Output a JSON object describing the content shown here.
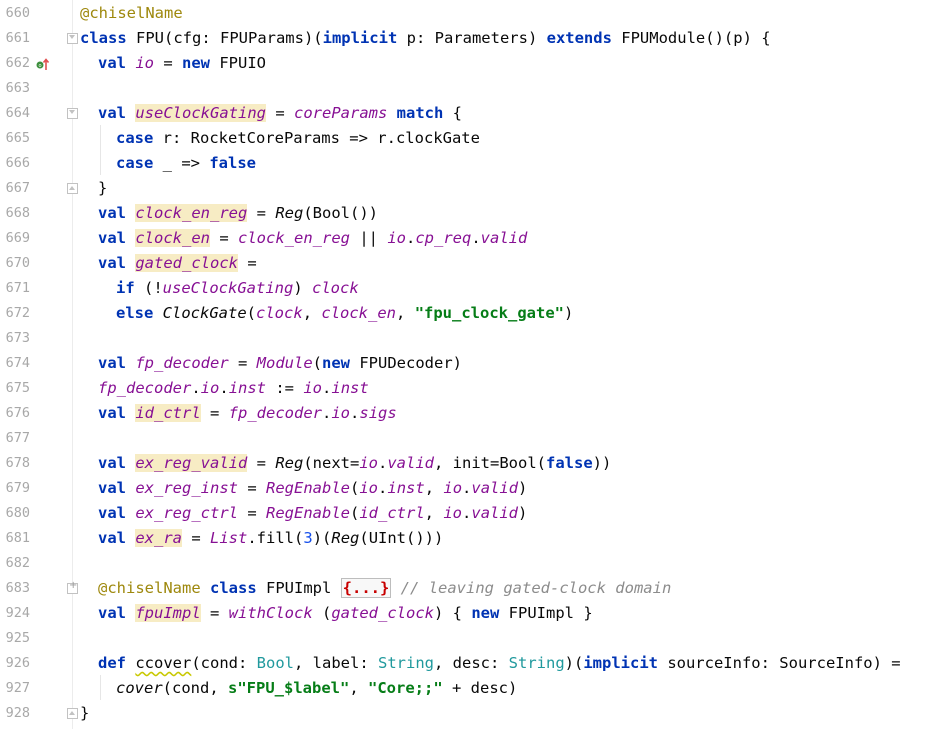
{
  "editor": {
    "first_line": 660,
    "line_numbers": [
      "660",
      "661",
      "662",
      "663",
      "664",
      "665",
      "666",
      "667",
      "668",
      "669",
      "670",
      "671",
      "672",
      "673",
      "674",
      "675",
      "676",
      "677",
      "678",
      "679",
      "680",
      "681",
      "682",
      "683",
      "924",
      "925",
      "926",
      "927",
      "928"
    ],
    "code": {
      "l660": "@chiselName",
      "l661_class": "class",
      "l661_name": " FPU(cfg: FPUParams)(",
      "l661_implicit": "implicit",
      "l661_rest": " p: Parameters) ",
      "l661_extends": "extends",
      "l661_end": " FPUModule()(p) {",
      "l662_val": "val",
      "l662_io": "io",
      "l662_eq": " = ",
      "l662_new": "new",
      "l662_end": " FPUIO",
      "l664_val": "val",
      "l664_name": "useClockGating",
      "l664_eq": " = ",
      "l664_core": "coreParams",
      "l664_match": "match",
      "l664_end": " {",
      "l665_case": "case",
      "l665_rest": " r: RocketCoreParams => r.clockGate",
      "l666_case": "case",
      "l666_rest": " _ => ",
      "l666_false": "false",
      "l667": "}",
      "l668_val": "val",
      "l668_name": "clock_en_reg",
      "l668_eq": " = ",
      "l668_reg": "Reg",
      "l668_end": "(Bool())",
      "l669_val": "val",
      "l669_name": "clock_en",
      "l669_eq": " = ",
      "l669_ref": "clock_en_reg",
      "l669_or": " || ",
      "l669_io": "io",
      "l669_dot": ".",
      "l669_cp": "cp_req",
      "l669_dot2": ".",
      "l669_valid": "valid",
      "l670_val": "val",
      "l670_name": "gated_clock",
      "l670_eq": " =",
      "l671_if": "if",
      "l671_paren": " (!",
      "l671_ucg": "useClockGating",
      "l671_close": ") ",
      "l671_clock": "clock",
      "l672_else": "else",
      "l672_cg": "ClockGate",
      "l672_open": "(",
      "l672_clock": "clock",
      "l672_comma": ", ",
      "l672_clken": "clock_en",
      "l672_comma2": ", ",
      "l672_str": "\"fpu_clock_gate\"",
      "l672_end": ")",
      "l674_val": "val",
      "l674_name": "fp_decoder",
      "l674_eq": " = ",
      "l674_mod": "Module",
      "l674_open": "(",
      "l674_new": "new",
      "l674_end": " FPUDecoder)",
      "l675_fd": "fp_decoder",
      "l675_dot": ".",
      "l675_io": "io",
      "l675_dot2": ".",
      "l675_inst": "inst",
      "l675_assign": " := ",
      "l675_io2": "io",
      "l675_dot3": ".",
      "l675_inst2": "inst",
      "l676_val": "val",
      "l676_name": "id_ctrl",
      "l676_eq": " = ",
      "l676_fd": "fp_decoder",
      "l676_dot": ".",
      "l676_io": "io",
      "l676_dot2": ".",
      "l676_sigs": "sigs",
      "l678_val": "val",
      "l678_name": "ex_reg_valid",
      "l678_eq": " = ",
      "l678_reg": "Reg",
      "l678_open": "(next=",
      "l678_io": "io",
      "l678_dot": ".",
      "l678_valid": "valid",
      "l678_mid": ", init=Bool(",
      "l678_false": "false",
      "l678_end": "))",
      "l679_val": "val",
      "l679_name": "ex_reg_inst",
      "l679_eq": " = ",
      "l679_re": "RegEnable",
      "l679_open": "(",
      "l679_io": "io",
      "l679_dot": ".",
      "l679_inst": "inst",
      "l679_comma": ", ",
      "l679_io2": "io",
      "l679_dot2": ".",
      "l679_valid": "valid",
      "l679_end": ")",
      "l680_val": "val",
      "l680_name": "ex_reg_ctrl",
      "l680_eq": " = ",
      "l680_re": "RegEnable",
      "l680_open": "(",
      "l680_id": "id_ctrl",
      "l680_comma": ", ",
      "l680_io": "io",
      "l680_dot": ".",
      "l680_valid": "valid",
      "l680_end": ")",
      "l681_val": "val",
      "l681_name": "ex_ra",
      "l681_eq": " = ",
      "l681_list": "List",
      "l681_fill": ".fill(",
      "l681_num": "3",
      "l681_mid": ")(",
      "l681_reg": "Reg",
      "l681_end": "(UInt()))",
      "l683_ann": "@chiselName",
      "l683_sp": " ",
      "l683_class": "class",
      "l683_name": " FPUImpl ",
      "l683_fold": "{...}",
      "l683_cmt": " // leaving gated-clock domain",
      "l924_val": "val",
      "l924_name": "fpuImpl",
      "l924_eq": " = ",
      "l924_wc": "withClock",
      "l924_open": " (",
      "l924_gc": "gated_clock",
      "l924_mid": ") { ",
      "l924_new": "new",
      "l924_end": " FPUImpl }",
      "l926_def": "def",
      "l926_sp": " ",
      "l926_name": "ccover",
      "l926_open": "(cond: ",
      "l926_bool": "Bool",
      "l926_c1": ", label: ",
      "l926_string": "String",
      "l926_c2": ", desc: ",
      "l926_string2": "String",
      "l926_c3": ")(",
      "l926_implicit": "implicit",
      "l926_end": " sourceInfo: SourceInfo) =",
      "l927_cover": "cover",
      "l927_open": "(cond, ",
      "l927_str1": "s\"FPU_$label\"",
      "l927_comma": ", ",
      "l927_str2": "\"Core;;\"",
      "l927_end": " + desc)",
      "l928": "}"
    },
    "colors": {
      "keyword": "#0033b3",
      "annotation": "#9e880d",
      "member": "#871094",
      "type": "#20999d",
      "string": "#067d17",
      "number": "#1750eb",
      "comment": "#8c8c8c",
      "highlight": "#f7ecc4"
    },
    "icons": {
      "line_662": "override-up-arrow-icon"
    }
  }
}
